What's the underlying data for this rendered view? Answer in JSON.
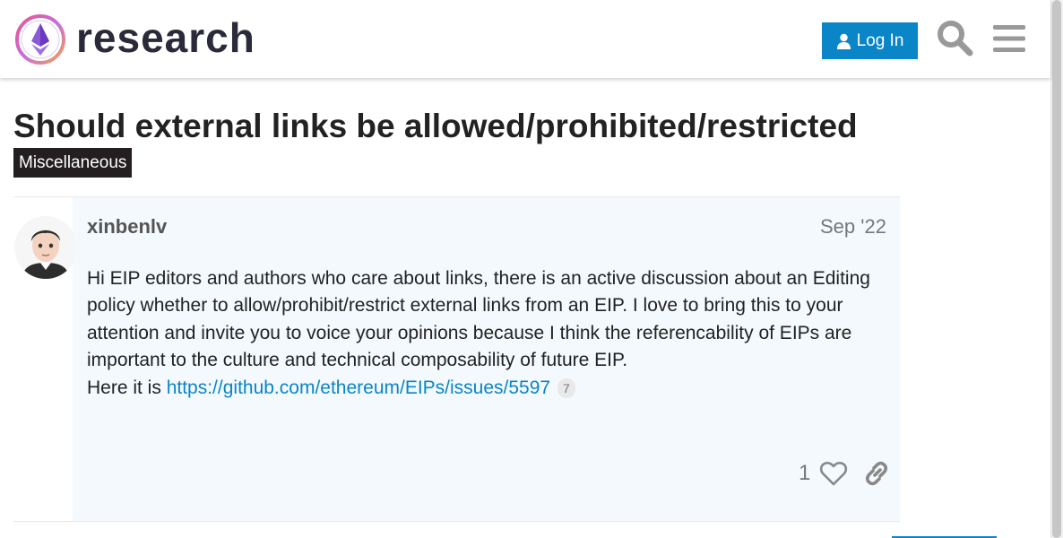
{
  "header": {
    "logo_text": "research",
    "login_label": "Log In"
  },
  "topic": {
    "title": "Should external links be allowed/prohibited/restricted",
    "category": "Miscellaneous"
  },
  "post": {
    "username": "xinbenlv",
    "date": "Sep '22",
    "body_text": "Hi EIP editors and authors who care about links, there is an active discussion about an Editing policy whether to allow/prohibit/restrict external links from an EIP. I love to bring this to your attention and invite you to voice your opinions because I think the referencability of EIPs are important to the culture and technical composability of future EIP.",
    "here_prefix": "Here it is ",
    "link_text": "https://github.com/ethereum/EIPs/issues/5597",
    "link_clicks": "7",
    "like_count": "1"
  },
  "colors": {
    "accent": "#0a85c7",
    "category_bg": "#231f20",
    "post_bg": "#f3f9fd"
  },
  "icons": [
    "user-icon",
    "search-icon",
    "hamburger-menu-icon",
    "heart-icon",
    "link-icon"
  ]
}
